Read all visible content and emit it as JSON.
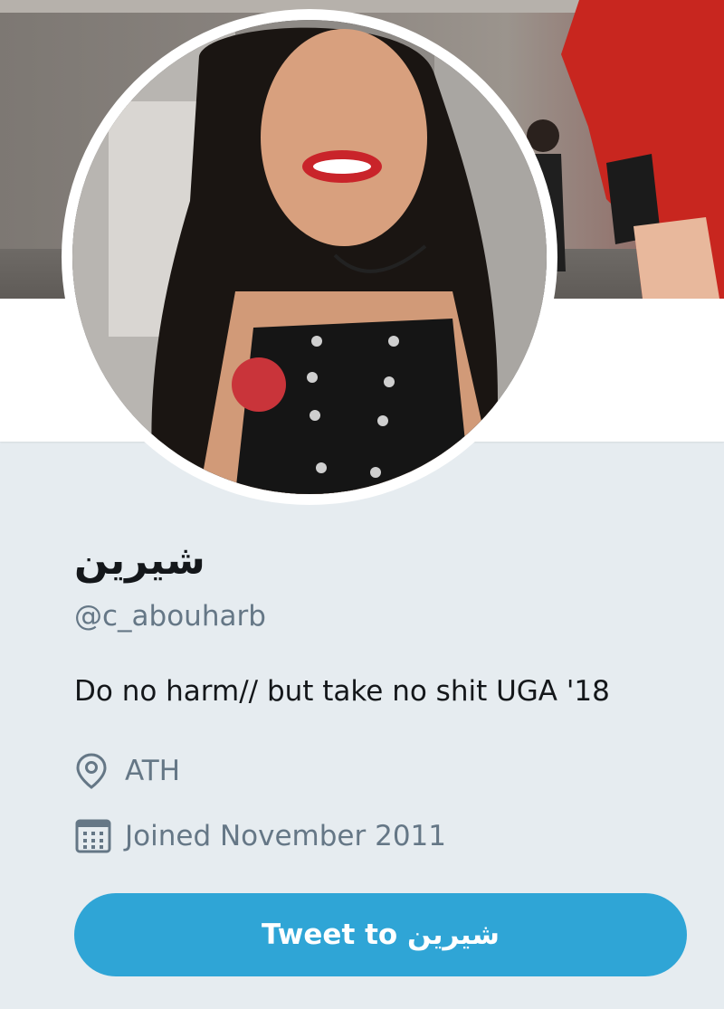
{
  "profile": {
    "name": "شيرين",
    "screen_name": "@c_abouharb",
    "bio": "Do no harm// but take no shit UGA '18",
    "location": "ATH",
    "joined": "Joined November 2011"
  },
  "actions": {
    "tweet_to_label": "Tweet to شيرين"
  },
  "icons": {
    "location": "location-pin-icon",
    "joined": "calendar-icon"
  },
  "colors": {
    "background": "#e6ecf0",
    "accent": "#2fa5d6",
    "secondary_text": "#657786",
    "primary_text": "#14171a"
  }
}
